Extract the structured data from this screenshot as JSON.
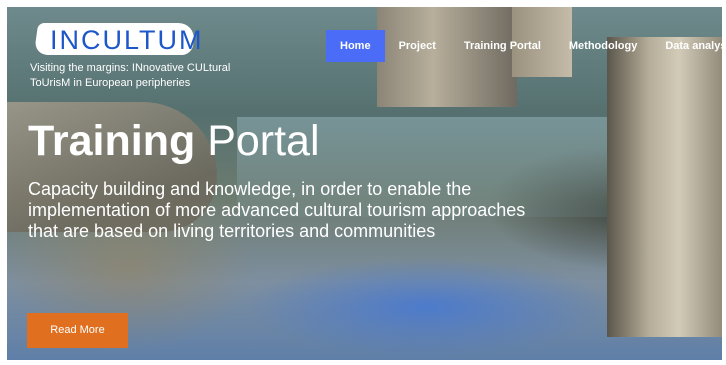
{
  "brand": {
    "logo_text": "INCULTUM",
    "tagline": "Visiting the margins: INnovative CULtural ToUrisM in European peripheries"
  },
  "nav": {
    "items": [
      {
        "label": "Home",
        "active": true
      },
      {
        "label": "Project",
        "active": false
      },
      {
        "label": "Training Portal",
        "active": false
      },
      {
        "label": "Methodology",
        "active": false
      },
      {
        "label": "Data analysis",
        "active": false
      }
    ]
  },
  "hero": {
    "title_bold": "Training",
    "title_light": "Portal",
    "description": "Capacity building and knowledge, in order to enable the implementation of more advanced cultural tourism approaches that are based on living territories and communities",
    "cta_label": "Read More"
  },
  "colors": {
    "nav_active": "#4a6cf7",
    "cta": "#e07020",
    "logo_text": "#1d57c9"
  }
}
